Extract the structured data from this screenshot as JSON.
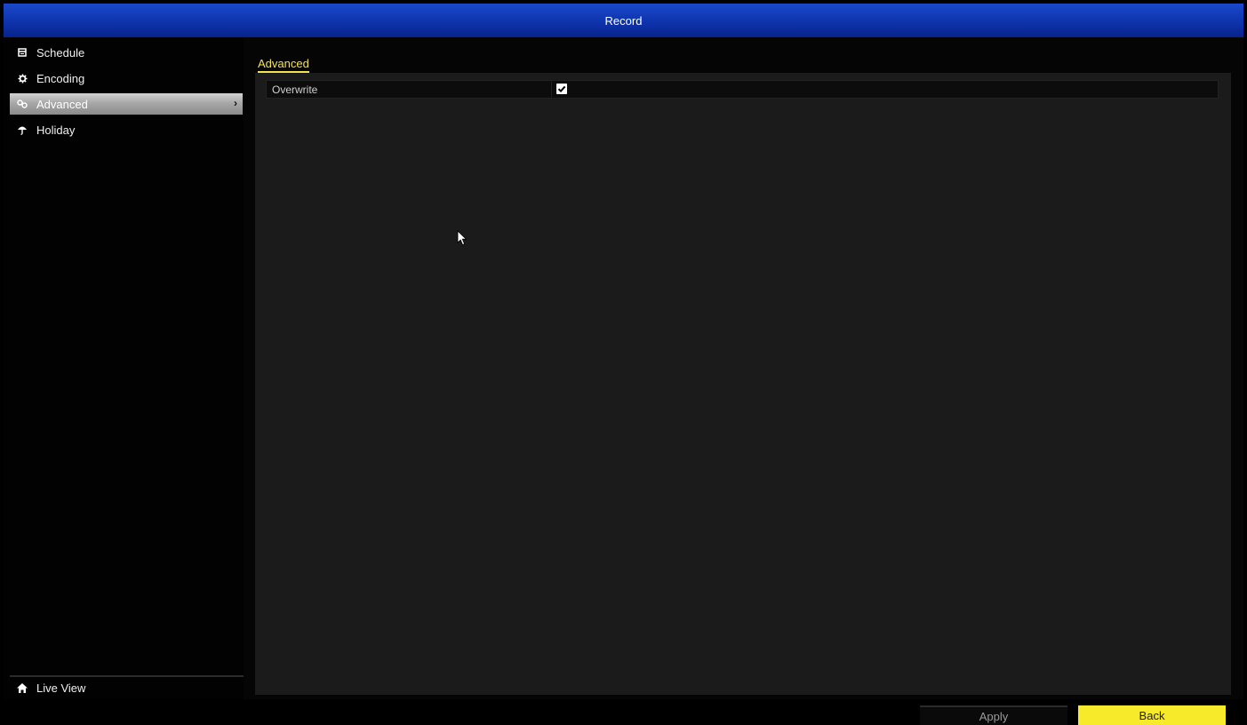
{
  "window": {
    "title": "Record"
  },
  "sidebar": {
    "items": [
      {
        "label": "Schedule",
        "icon": "calendar-icon"
      },
      {
        "label": "Encoding",
        "icon": "gear-icon"
      },
      {
        "label": "Advanced",
        "icon": "advanced-settings-icon",
        "active": true
      },
      {
        "label": "Holiday",
        "icon": "umbrella-icon"
      }
    ],
    "footer": {
      "label": "Live View",
      "icon": "home-icon"
    }
  },
  "main": {
    "tab": {
      "label": "Advanced"
    },
    "settings": [
      {
        "label": "Overwrite",
        "checked": true
      }
    ],
    "buttons": {
      "apply_label": "Apply",
      "back_label": "Back"
    }
  },
  "colors": {
    "titlebar": "#0f35b0",
    "accent_yellow": "#f7ea2a",
    "tab_yellow": "#f4e34a",
    "panel_bg": "#1b1b1b",
    "active_item": "#a8a8a8"
  }
}
